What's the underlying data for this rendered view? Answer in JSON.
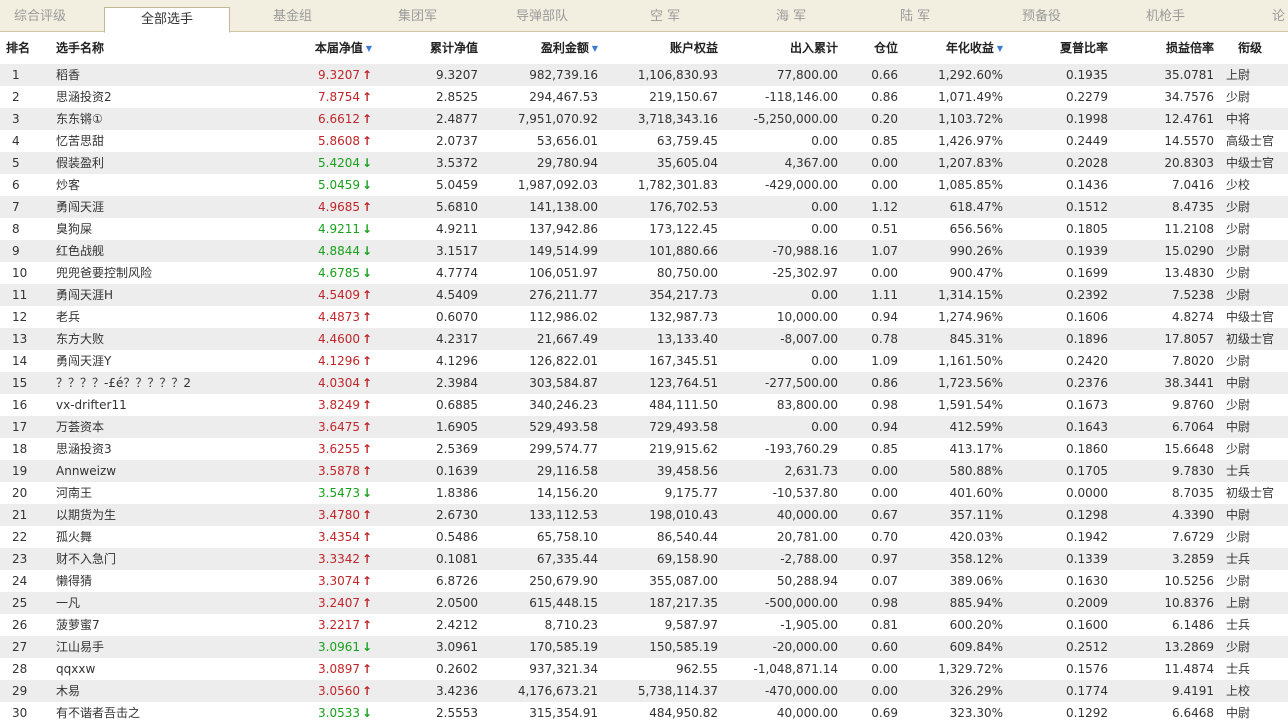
{
  "tabs": [
    "综合评级",
    "全部选手",
    "基金组",
    "集团军",
    "导弹部队",
    "空 军",
    "海 军",
    "陆 军",
    "预备役",
    "机枪手",
    "论"
  ],
  "active_tab": 1,
  "colors": {
    "up": "#c0262a",
    "down": "#19a11d",
    "sort": "#3a7bd5"
  },
  "headers": {
    "rank": "排名",
    "name": "选手名称",
    "nav": "本届净值",
    "cum": "累计净值",
    "profit": "盈利金额",
    "equity": "账户权益",
    "inout": "出入累计",
    "position": "仓位",
    "annual": "年化收益",
    "sharpe": "夏普比率",
    "plr": "损益倍率",
    "title": "衔级"
  },
  "rows": [
    {
      "rank": "1",
      "name": "稻香",
      "nav": "9.3207",
      "dir": "up",
      "cum": "9.3207",
      "profit": "982,739.16",
      "equity": "1,106,830.93",
      "inout": "77,800.00",
      "position": "0.66",
      "annual": "1,292.60%",
      "sharpe": "0.1935",
      "plr": "35.0781",
      "title": "上尉"
    },
    {
      "rank": "2",
      "name": "思涵投资2",
      "nav": "7.8754",
      "dir": "up",
      "cum": "2.8525",
      "profit": "294,467.53",
      "equity": "219,150.67",
      "inout": "-118,146.00",
      "position": "0.86",
      "annual": "1,071.49%",
      "sharpe": "0.2279",
      "plr": "34.7576",
      "title": "少尉"
    },
    {
      "rank": "3",
      "name": "东东锵①",
      "nav": "6.6612",
      "dir": "up",
      "cum": "2.4877",
      "profit": "7,951,070.92",
      "equity": "3,718,343.16",
      "inout": "-5,250,000.00",
      "position": "0.20",
      "annual": "1,103.72%",
      "sharpe": "0.1998",
      "plr": "12.4761",
      "title": "中将"
    },
    {
      "rank": "4",
      "name": "忆苦思甜",
      "nav": "5.8608",
      "dir": "up",
      "cum": "2.0737",
      "profit": "53,656.01",
      "equity": "63,759.45",
      "inout": "0.00",
      "position": "0.85",
      "annual": "1,426.97%",
      "sharpe": "0.2449",
      "plr": "14.5570",
      "title": "高级士官"
    },
    {
      "rank": "5",
      "name": "假装盈利",
      "nav": "5.4204",
      "dir": "down",
      "cum": "3.5372",
      "profit": "29,780.94",
      "equity": "35,605.04",
      "inout": "4,367.00",
      "position": "0.00",
      "annual": "1,207.83%",
      "sharpe": "0.2028",
      "plr": "20.8303",
      "title": "中级士官"
    },
    {
      "rank": "6",
      "name": "炒客",
      "nav": "5.0459",
      "dir": "down",
      "cum": "5.0459",
      "profit": "1,987,092.03",
      "equity": "1,782,301.83",
      "inout": "-429,000.00",
      "position": "0.00",
      "annual": "1,085.85%",
      "sharpe": "0.1436",
      "plr": "7.0416",
      "title": "少校"
    },
    {
      "rank": "7",
      "name": "勇闯天涯",
      "nav": "4.9685",
      "dir": "up",
      "cum": "5.6810",
      "profit": "141,138.00",
      "equity": "176,702.53",
      "inout": "0.00",
      "position": "1.12",
      "annual": "618.47%",
      "sharpe": "0.1512",
      "plr": "8.4735",
      "title": "少尉"
    },
    {
      "rank": "8",
      "name": "臭狗屎",
      "nav": "4.9211",
      "dir": "down",
      "cum": "4.9211",
      "profit": "137,942.86",
      "equity": "173,122.45",
      "inout": "0.00",
      "position": "0.51",
      "annual": "656.56%",
      "sharpe": "0.1805",
      "plr": "11.2108",
      "title": "少尉"
    },
    {
      "rank": "9",
      "name": "红色战舰",
      "nav": "4.8844",
      "dir": "down",
      "cum": "3.1517",
      "profit": "149,514.99",
      "equity": "101,880.66",
      "inout": "-70,988.16",
      "position": "1.07",
      "annual": "990.26%",
      "sharpe": "0.1939",
      "plr": "15.0290",
      "title": "少尉"
    },
    {
      "rank": "10",
      "name": "兜兜爸要控制风险",
      "nav": "4.6785",
      "dir": "down",
      "cum": "4.7774",
      "profit": "106,051.97",
      "equity": "80,750.00",
      "inout": "-25,302.97",
      "position": "0.00",
      "annual": "900.47%",
      "sharpe": "0.1699",
      "plr": "13.4830",
      "title": "少尉"
    },
    {
      "rank": "11",
      "name": "勇闯天涯H",
      "nav": "4.5409",
      "dir": "up",
      "cum": "4.5409",
      "profit": "276,211.77",
      "equity": "354,217.73",
      "inout": "0.00",
      "position": "1.11",
      "annual": "1,314.15%",
      "sharpe": "0.2392",
      "plr": "7.5238",
      "title": "少尉"
    },
    {
      "rank": "12",
      "name": "老兵",
      "nav": "4.4873",
      "dir": "up",
      "cum": "0.6070",
      "profit": "112,986.02",
      "equity": "132,987.73",
      "inout": "10,000.00",
      "position": "0.94",
      "annual": "1,274.96%",
      "sharpe": "0.1606",
      "plr": "4.8274",
      "title": "中级士官"
    },
    {
      "rank": "13",
      "name": "东方大败",
      "nav": "4.4600",
      "dir": "up",
      "cum": "4.2317",
      "profit": "21,667.49",
      "equity": "13,133.40",
      "inout": "-8,007.00",
      "position": "0.78",
      "annual": "845.31%",
      "sharpe": "0.1896",
      "plr": "17.8057",
      "title": "初级士官"
    },
    {
      "rank": "14",
      "name": "勇闯天涯Y",
      "nav": "4.1296",
      "dir": "up",
      "cum": "4.1296",
      "profit": "126,822.01",
      "equity": "167,345.51",
      "inout": "0.00",
      "position": "1.09",
      "annual": "1,161.50%",
      "sharpe": "0.2420",
      "plr": "7.8020",
      "title": "少尉"
    },
    {
      "rank": "15",
      "name": "？？？？-£é？？？？？2",
      "nav": "4.0304",
      "dir": "up",
      "cum": "2.3984",
      "profit": "303,584.87",
      "equity": "123,764.51",
      "inout": "-277,500.00",
      "position": "0.86",
      "annual": "1,723.56%",
      "sharpe": "0.2376",
      "plr": "38.3441",
      "title": "中尉"
    },
    {
      "rank": "16",
      "name": "vx-drifter11",
      "nav": "3.8249",
      "dir": "up",
      "cum": "0.6885",
      "profit": "340,246.23",
      "equity": "484,111.50",
      "inout": "83,800.00",
      "position": "0.98",
      "annual": "1,591.54%",
      "sharpe": "0.1673",
      "plr": "9.8760",
      "title": "少尉"
    },
    {
      "rank": "17",
      "name": "万荟资本",
      "nav": "3.6475",
      "dir": "up",
      "cum": "1.6905",
      "profit": "529,493.58",
      "equity": "729,493.58",
      "inout": "0.00",
      "position": "0.94",
      "annual": "412.59%",
      "sharpe": "0.1643",
      "plr": "6.7064",
      "title": "中尉"
    },
    {
      "rank": "18",
      "name": "思涵投资3",
      "nav": "3.6255",
      "dir": "up",
      "cum": "2.5369",
      "profit": "299,574.77",
      "equity": "219,915.62",
      "inout": "-193,760.29",
      "position": "0.85",
      "annual": "413.17%",
      "sharpe": "0.1860",
      "plr": "15.6648",
      "title": "少尉"
    },
    {
      "rank": "19",
      "name": "Annweizw",
      "nav": "3.5878",
      "dir": "up",
      "cum": "0.1639",
      "profit": "29,116.58",
      "equity": "39,458.56",
      "inout": "2,631.73",
      "position": "0.00",
      "annual": "580.88%",
      "sharpe": "0.1705",
      "plr": "9.7830",
      "title": "士兵"
    },
    {
      "rank": "20",
      "name": "河南王",
      "nav": "3.5473",
      "dir": "down",
      "cum": "1.8386",
      "profit": "14,156.20",
      "equity": "9,175.77",
      "inout": "-10,537.80",
      "position": "0.00",
      "annual": "401.60%",
      "sharpe": "0.0000",
      "plr": "8.7035",
      "title": "初级士官"
    },
    {
      "rank": "21",
      "name": "以期货为生",
      "nav": "3.4780",
      "dir": "up",
      "cum": "2.6730",
      "profit": "133,112.53",
      "equity": "198,010.43",
      "inout": "40,000.00",
      "position": "0.67",
      "annual": "357.11%",
      "sharpe": "0.1298",
      "plr": "4.3390",
      "title": "中尉"
    },
    {
      "rank": "22",
      "name": "孤火舞",
      "nav": "3.4354",
      "dir": "up",
      "cum": "0.5486",
      "profit": "65,758.10",
      "equity": "86,540.44",
      "inout": "20,781.00",
      "position": "0.70",
      "annual": "420.03%",
      "sharpe": "0.1942",
      "plr": "7.6729",
      "title": "少尉"
    },
    {
      "rank": "23",
      "name": "财不入急门",
      "nav": "3.3342",
      "dir": "up",
      "cum": "0.1081",
      "profit": "67,335.44",
      "equity": "69,158.90",
      "inout": "-2,788.00",
      "position": "0.97",
      "annual": "358.12%",
      "sharpe": "0.1339",
      "plr": "3.2859",
      "title": "士兵"
    },
    {
      "rank": "24",
      "name": "懒得猜",
      "nav": "3.3074",
      "dir": "up",
      "cum": "6.8726",
      "profit": "250,679.90",
      "equity": "355,087.00",
      "inout": "50,288.94",
      "position": "0.07",
      "annual": "389.06%",
      "sharpe": "0.1630",
      "plr": "10.5256",
      "title": "少尉"
    },
    {
      "rank": "25",
      "name": "一凡",
      "nav": "3.2407",
      "dir": "up",
      "cum": "2.0500",
      "profit": "615,448.15",
      "equity": "187,217.35",
      "inout": "-500,000.00",
      "position": "0.98",
      "annual": "885.94%",
      "sharpe": "0.2009",
      "plr": "10.8376",
      "title": "上尉"
    },
    {
      "rank": "26",
      "name": "菠萝蜜7",
      "nav": "3.2217",
      "dir": "up",
      "cum": "2.4212",
      "profit": "8,710.23",
      "equity": "9,587.97",
      "inout": "-1,905.00",
      "position": "0.81",
      "annual": "600.20%",
      "sharpe": "0.1600",
      "plr": "6.1486",
      "title": "士兵"
    },
    {
      "rank": "27",
      "name": "江山易手",
      "nav": "3.0961",
      "dir": "down",
      "cum": "3.0961",
      "profit": "170,585.19",
      "equity": "150,585.19",
      "inout": "-20,000.00",
      "position": "0.60",
      "annual": "609.84%",
      "sharpe": "0.2512",
      "plr": "13.2869",
      "title": "少尉"
    },
    {
      "rank": "28",
      "name": "qqxxw",
      "nav": "3.0897",
      "dir": "up",
      "cum": "0.2602",
      "profit": "937,321.34",
      "equity": "962.55",
      "inout": "-1,048,871.14",
      "position": "0.00",
      "annual": "1,329.72%",
      "sharpe": "0.1576",
      "plr": "11.4874",
      "title": "士兵"
    },
    {
      "rank": "29",
      "name": "木易",
      "nav": "3.0560",
      "dir": "up",
      "cum": "3.4236",
      "profit": "4,176,673.21",
      "equity": "5,738,114.37",
      "inout": "-470,000.00",
      "position": "0.00",
      "annual": "326.29%",
      "sharpe": "0.1774",
      "plr": "9.4191",
      "title": "上校"
    },
    {
      "rank": "30",
      "name": "有不谐者吾击之",
      "nav": "3.0533",
      "dir": "down",
      "cum": "2.5553",
      "profit": "315,354.91",
      "equity": "484,950.82",
      "inout": "40,000.00",
      "position": "0.69",
      "annual": "323.30%",
      "sharpe": "0.1292",
      "plr": "6.6468",
      "title": "中尉"
    }
  ]
}
